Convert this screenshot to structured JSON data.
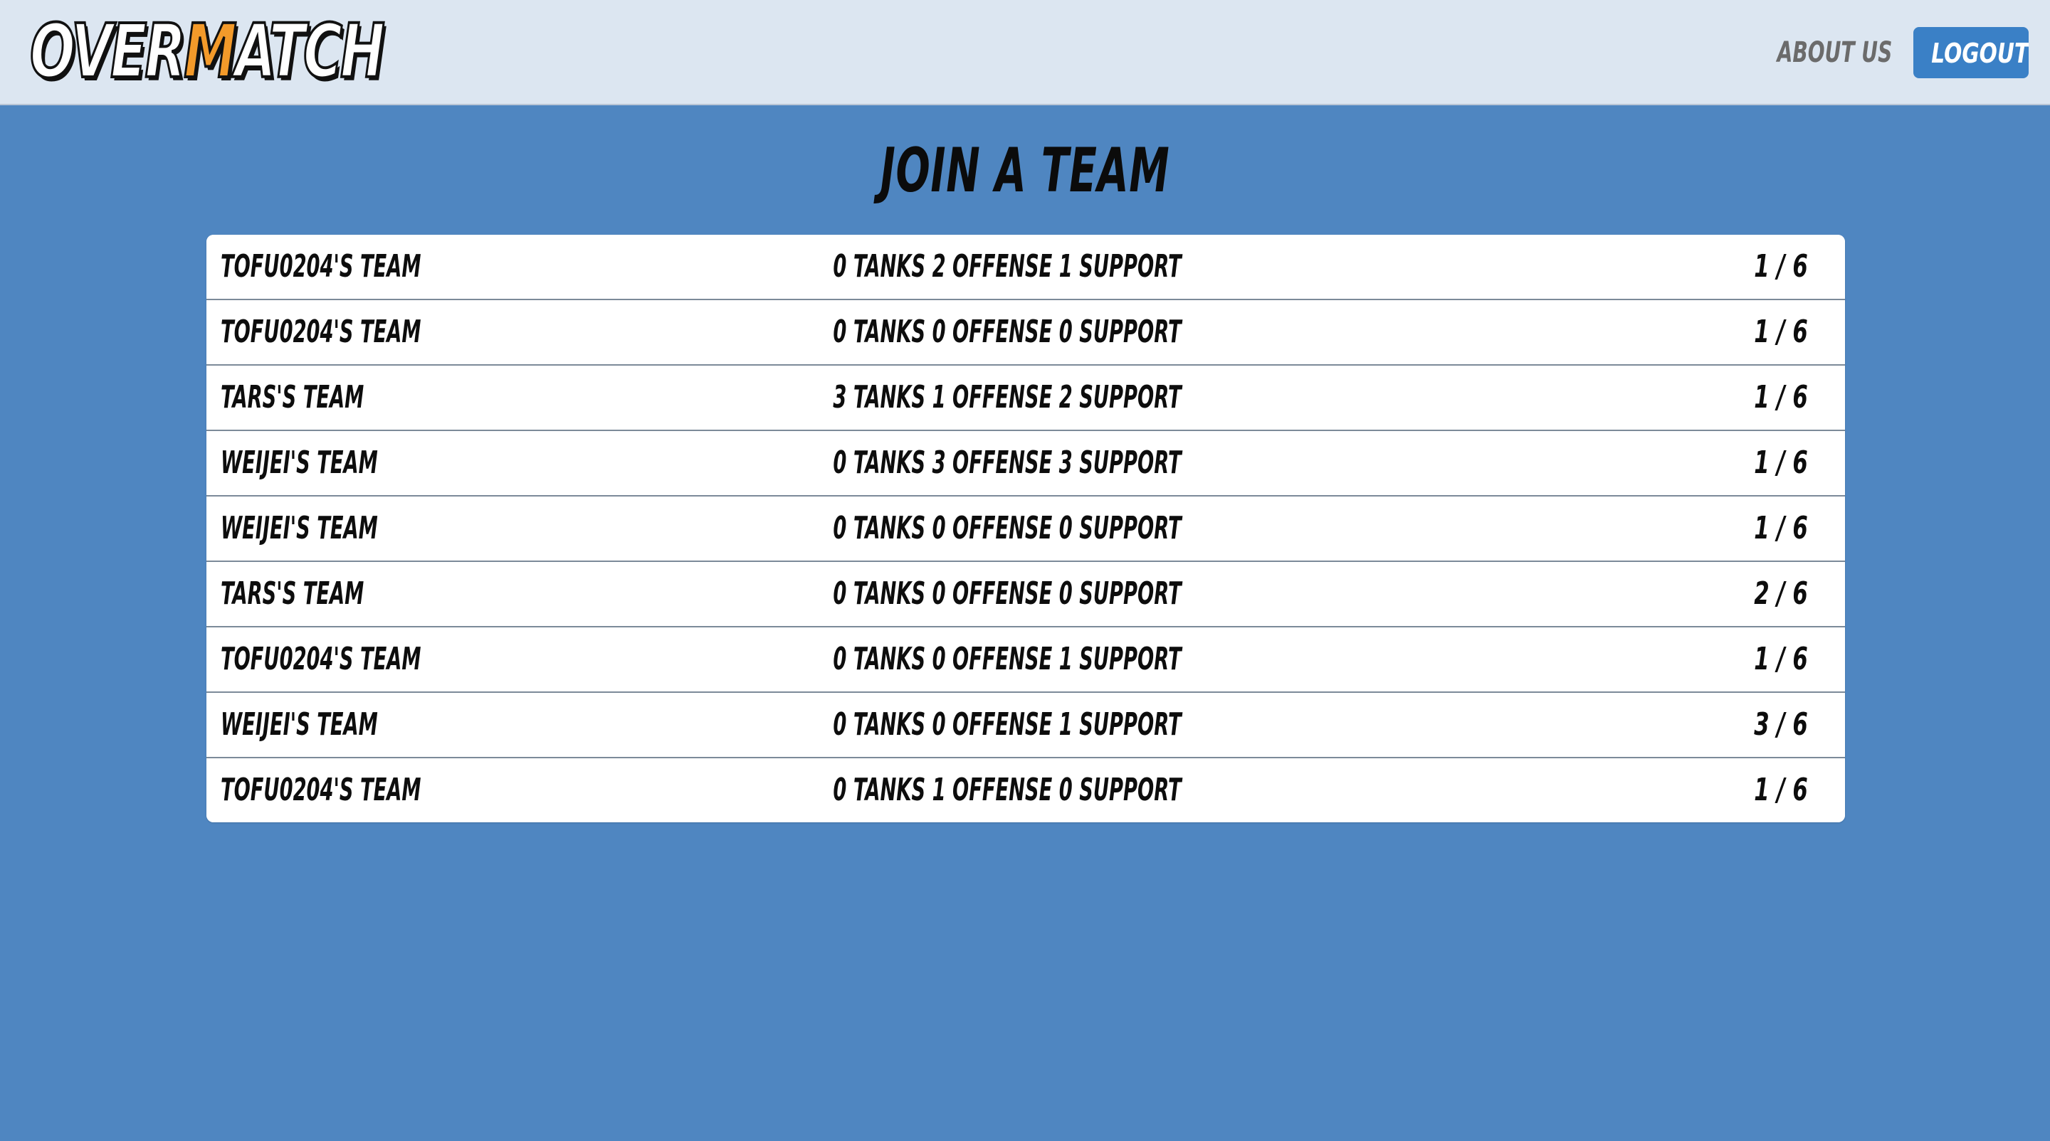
{
  "header": {
    "logo_prefix": "OVER",
    "logo_accent": "M",
    "logo_suffix": "ATCH",
    "about_label": "ABOUT US",
    "logout_label": "LOGOUT"
  },
  "main": {
    "title": "JOIN A TEAM",
    "teams": [
      {
        "name": "TOFU0204'S TEAM",
        "roles": "0 TANKS 2 OFFENSE 1 SUPPORT",
        "count": "1 / 6"
      },
      {
        "name": "TOFU0204'S TEAM",
        "roles": "0 TANKS 0 OFFENSE 0 SUPPORT",
        "count": "1 / 6"
      },
      {
        "name": "TARS'S TEAM",
        "roles": "3 TANKS 1 OFFENSE 2 SUPPORT",
        "count": "1 / 6"
      },
      {
        "name": "WEIJEI'S TEAM",
        "roles": "0 TANKS 3 OFFENSE 3 SUPPORT",
        "count": "1 / 6"
      },
      {
        "name": "WEIJEI'S TEAM",
        "roles": "0 TANKS 0 OFFENSE 0 SUPPORT",
        "count": "1 / 6"
      },
      {
        "name": "TARS'S TEAM",
        "roles": "0 TANKS 0 OFFENSE 0 SUPPORT",
        "count": "2 / 6"
      },
      {
        "name": "TOFU0204'S TEAM",
        "roles": "0 TANKS 0 OFFENSE 1 SUPPORT",
        "count": "1 / 6"
      },
      {
        "name": "WEIJEI'S TEAM",
        "roles": "0 TANKS 0 OFFENSE 1 SUPPORT",
        "count": "3 / 6"
      },
      {
        "name": "TOFU0204'S TEAM",
        "roles": "0 TANKS 1 OFFENSE 0 SUPPORT",
        "count": "1 / 6"
      }
    ]
  },
  "colors": {
    "background": "#4f86c1",
    "navbar": "#dce6f1",
    "logo_accent": "#f39a2a",
    "logout_button": "#3a80c6"
  }
}
